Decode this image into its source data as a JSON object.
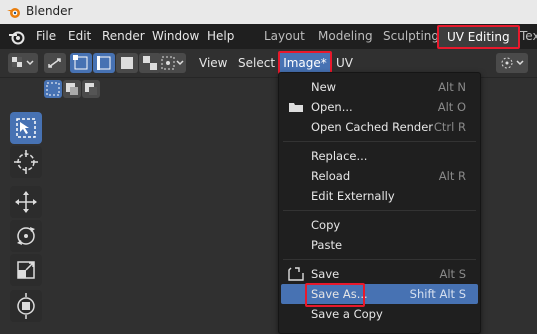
{
  "window": {
    "title": "Blender"
  },
  "menubar": {
    "items": [
      "File",
      "Edit",
      "Render",
      "Window",
      "Help"
    ],
    "workspaces": [
      "Layout",
      "Modeling",
      "Sculpting",
      "UV Editing",
      "Tex"
    ]
  },
  "toolbar": {
    "view_label": "View",
    "select_label": "Select",
    "image_label": "Image*",
    "uv_label": "UV"
  },
  "image_menu": {
    "items": [
      {
        "label": "New",
        "shortcut": "Alt N"
      },
      {
        "label": "Open...",
        "shortcut": "Alt O"
      },
      {
        "label": "Open Cached Render",
        "shortcut": "Ctrl R"
      },
      {
        "label": "Replace...",
        "shortcut": ""
      },
      {
        "label": "Reload",
        "shortcut": "Alt R"
      },
      {
        "label": "Edit Externally",
        "shortcut": ""
      },
      {
        "label": "Copy",
        "shortcut": ""
      },
      {
        "label": "Paste",
        "shortcut": ""
      },
      {
        "label": "Save",
        "shortcut": "Alt S"
      },
      {
        "label": "Save As...",
        "shortcut": "Shift Alt S"
      },
      {
        "label": "Save a Copy",
        "shortcut": ""
      }
    ]
  }
}
